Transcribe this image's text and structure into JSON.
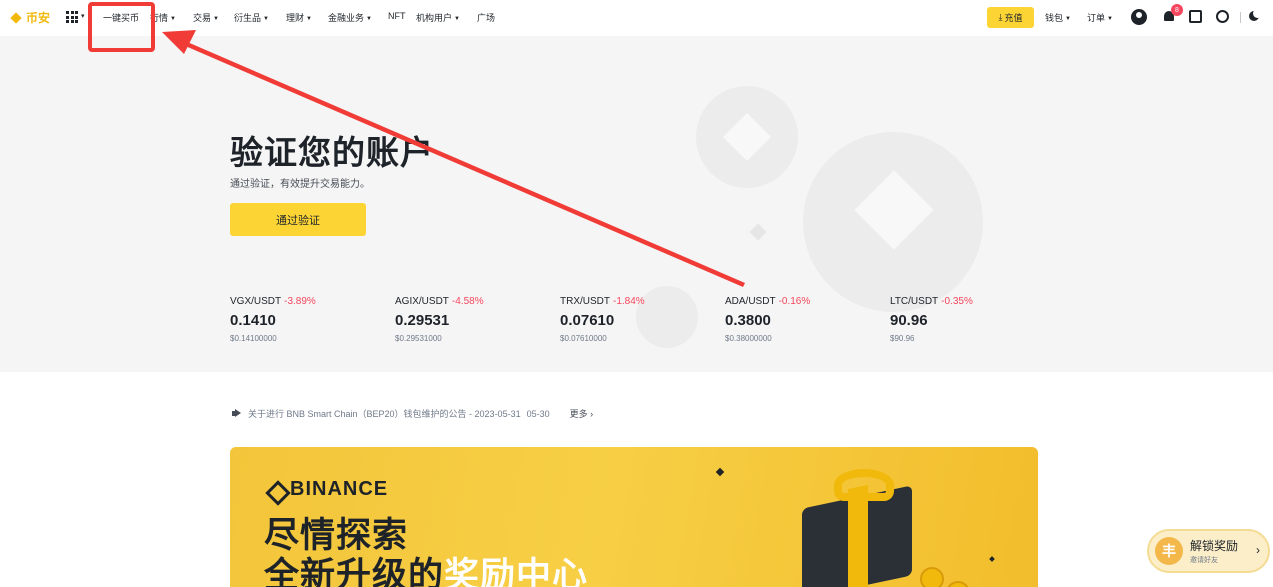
{
  "header": {
    "logo_text": "币安",
    "nav": [
      {
        "label": "一键买币",
        "dropdown": false
      },
      {
        "label": "行情",
        "dropdown": true
      },
      {
        "label": "交易",
        "dropdown": true
      },
      {
        "label": "衍生品",
        "dropdown": true
      },
      {
        "label": "理财",
        "dropdown": true
      },
      {
        "label": "金融业务",
        "dropdown": true
      },
      {
        "label": "NFT",
        "dropdown": false
      },
      {
        "label": "机构用户",
        "dropdown": true
      },
      {
        "label": "广场",
        "dropdown": false
      }
    ],
    "deposit_label": "充值",
    "wallet_label": "钱包",
    "orders_label": "订单",
    "notification_count": "8"
  },
  "hero": {
    "title": "验证您的账户",
    "subtitle": "通过验证，有效提升交易能力。",
    "verify_button": "通过验证"
  },
  "tickers": [
    {
      "pair": "VGX/USDT",
      "change": "-3.89%",
      "price": "0.1410",
      "usd": "$0.14100000"
    },
    {
      "pair": "AGIX/USDT",
      "change": "-4.58%",
      "price": "0.29531",
      "usd": "$0.29531000"
    },
    {
      "pair": "TRX/USDT",
      "change": "-1.84%",
      "price": "0.07610",
      "usd": "$0.07610000"
    },
    {
      "pair": "ADA/USDT",
      "change": "-0.16%",
      "price": "0.3800",
      "usd": "$0.38000000"
    },
    {
      "pair": "LTC/USDT",
      "change": "-0.35%",
      "price": "90.96",
      "usd": "$90.96"
    }
  ],
  "announcement": {
    "text": "关于进行 BNB Smart Chain（BEP20）钱包维护的公告 - 2023-05-31",
    "date": "05-30",
    "more": "更多"
  },
  "banner": {
    "brand": "BINANCE",
    "line1": "尽情探索",
    "line2_a": "全新升级的",
    "line2_b": "奖励中心"
  },
  "reward_widget": {
    "icon_char": "丰",
    "title": "解锁奖励",
    "subtitle": "邀请好友"
  },
  "colors": {
    "brand_yellow": "#fcd535",
    "negative": "#f6465d",
    "annotation_red": "#f03b36"
  }
}
